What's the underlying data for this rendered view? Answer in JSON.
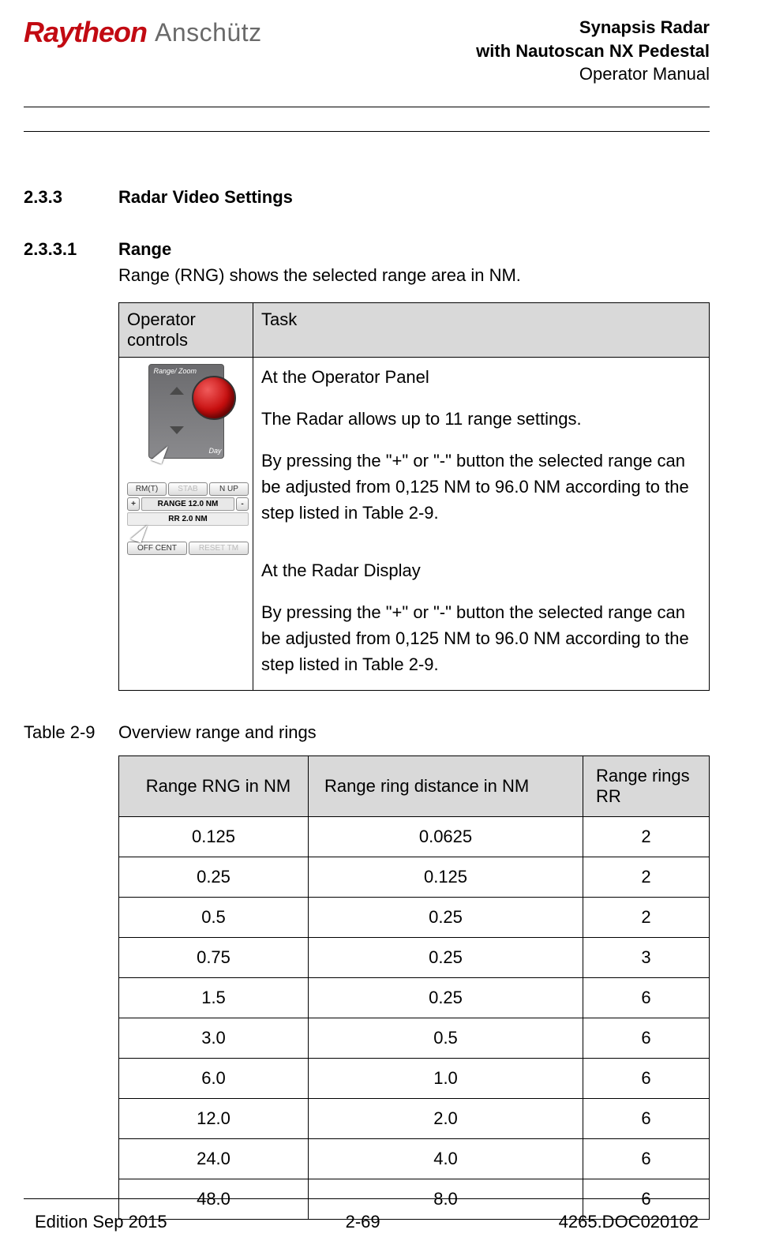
{
  "header": {
    "logo1": "Raytheon",
    "logo2": "Anschütz",
    "title_line1": "Synapsis Radar",
    "title_line2": "with Nautoscan NX Pedestal",
    "title_line3": "Operator Manual"
  },
  "section1": {
    "num": "2.3.3",
    "title": "Radar Video Settings"
  },
  "section2": {
    "num": "2.3.3.1",
    "title": "Range",
    "desc": "Range (RNG) shows the selected range area in NM."
  },
  "op_table": {
    "h1": "Operator controls",
    "h2": "Task",
    "knob_label": "Range/\nZoom",
    "knob_day": "Day",
    "ui": {
      "rm": "RM(T)",
      "stab": "STAB",
      "nup": "N UP",
      "plus": "+",
      "minus": "-",
      "range": "RANGE 12.0 NM",
      "rr": "RR 2.0 NM",
      "offcent": "OFF CENT",
      "reset": "RESET TM"
    },
    "task": {
      "p1": "At the Operator Panel",
      "p2": "The Radar allows up to 11 range settings.",
      "p3": "By pressing the \"+\" or \"-\" button the selected range can be adjusted from 0,125 NM to 96.0 NM according to the step listed in Table 2-9.",
      "p4": "At the Radar Display",
      "p5": "By pressing the \"+\" or \"-\" button the selected range can be adjusted from 0,125 NM to 96.0 NM according to the step listed in Table 2-9."
    }
  },
  "caption": {
    "num": "Table 2-9",
    "text": "Overview range and rings"
  },
  "rings": {
    "h1": "Range RNG in NM",
    "h2": "Range ring distance in NM",
    "h3": "Range rings RR",
    "rows": [
      {
        "a": "0.125",
        "b": "0.0625",
        "c": "2"
      },
      {
        "a": "0.25",
        "b": "0.125",
        "c": "2"
      },
      {
        "a": "0.5",
        "b": "0.25",
        "c": "2"
      },
      {
        "a": "0.75",
        "b": "0.25",
        "c": "3"
      },
      {
        "a": "1.5",
        "b": "0.25",
        "c": "6"
      },
      {
        "a": "3.0",
        "b": "0.5",
        "c": "6"
      },
      {
        "a": "6.0",
        "b": "1.0",
        "c": "6"
      },
      {
        "a": "12.0",
        "b": "2.0",
        "c": "6"
      },
      {
        "a": "24.0",
        "b": "4.0",
        "c": "6"
      },
      {
        "a": "48.0",
        "b": "8.0",
        "c": "6"
      }
    ]
  },
  "footer": {
    "left": "Edition Sep 2015",
    "mid": "2-69",
    "right": "4265.DOC020102"
  }
}
